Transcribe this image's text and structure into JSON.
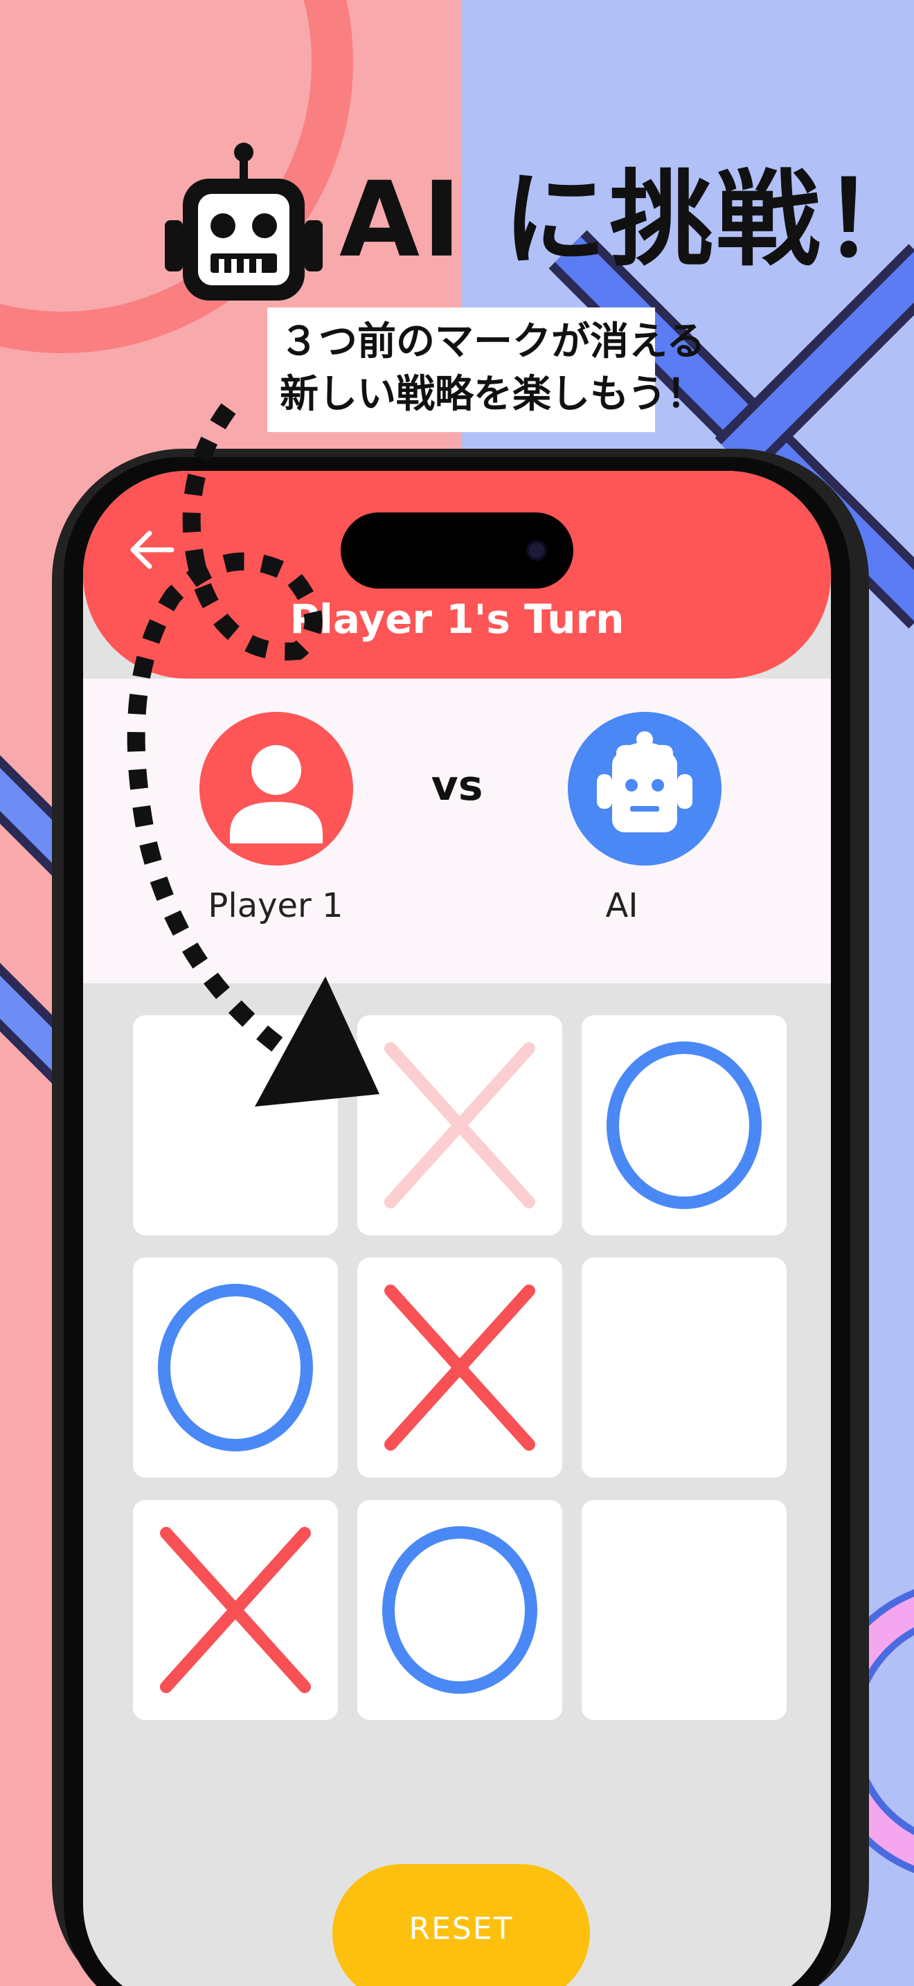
{
  "promo": {
    "headline": "AI に挑戦！",
    "caption_line1": "３つ前のマークが消える",
    "caption_line2": "新しい戦略を楽しもう！"
  },
  "header": {
    "turn_title": "Player 1's Turn",
    "back_icon": "arrow-left-icon"
  },
  "players": {
    "player1": {
      "name": "Player 1",
      "icon": "person-icon",
      "color": "#fe5556"
    },
    "vs_label": "vs",
    "ai": {
      "name": "AI",
      "icon": "robot-icon",
      "color": "#4a88f5"
    }
  },
  "board": {
    "cells": [
      {
        "index": 0,
        "mark": ""
      },
      {
        "index": 1,
        "mark": "X",
        "faded": true
      },
      {
        "index": 2,
        "mark": "O"
      },
      {
        "index": 3,
        "mark": "O"
      },
      {
        "index": 4,
        "mark": "X"
      },
      {
        "index": 5,
        "mark": ""
      },
      {
        "index": 6,
        "mark": "X"
      },
      {
        "index": 7,
        "mark": "O"
      },
      {
        "index": 8,
        "mark": ""
      }
    ],
    "x_color": "#f85155",
    "o_color": "#4a88f5"
  },
  "controls": {
    "reset_label": "RESET",
    "reset_color": "#fdc00e"
  },
  "colors": {
    "bg_left": "#f8a9ab",
    "bg_right": "#b2c0f8",
    "header": "#fe5556"
  }
}
